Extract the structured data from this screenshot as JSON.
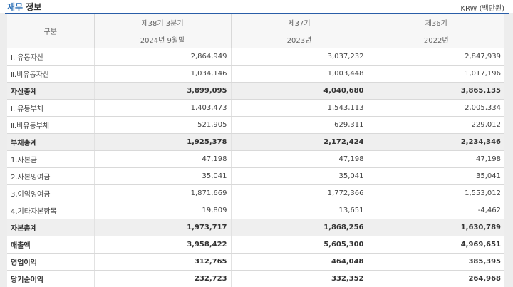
{
  "header": {
    "title_accent": "재무",
    "title_rest": " 정보",
    "unit": "KRW (백만원)"
  },
  "table": {
    "corner": "구분",
    "periods": [
      {
        "term": "제38기 3분기",
        "date": "2024년 9월말"
      },
      {
        "term": "제37기",
        "date": "2023년"
      },
      {
        "term": "제36기",
        "date": "2022년"
      }
    ],
    "rows": [
      {
        "label": "Ⅰ. 유동자산",
        "values": [
          "2,864,949",
          "3,037,232",
          "2,847,939"
        ],
        "style": "normal"
      },
      {
        "label": "Ⅱ.비유동자산",
        "values": [
          "1,034,146",
          "1,003,448",
          "1,017,196"
        ],
        "style": "normal"
      },
      {
        "label": "자산총계",
        "values": [
          "3,899,095",
          "4,040,680",
          "3,865,135"
        ],
        "style": "total"
      },
      {
        "label": "Ⅰ. 유동부채",
        "values": [
          "1,403,473",
          "1,543,113",
          "2,005,334"
        ],
        "style": "normal"
      },
      {
        "label": "Ⅱ.비유동부채",
        "values": [
          "521,905",
          "629,311",
          "229,012"
        ],
        "style": "normal"
      },
      {
        "label": "부채총계",
        "values": [
          "1,925,378",
          "2,172,424",
          "2,234,346"
        ],
        "style": "total"
      },
      {
        "label": "1.자본금",
        "values": [
          "47,198",
          "47,198",
          "47,198"
        ],
        "style": "normal"
      },
      {
        "label": "2.자본잉여금",
        "values": [
          "35,041",
          "35,041",
          "35,041"
        ],
        "style": "normal"
      },
      {
        "label": "3.이익잉여금",
        "values": [
          "1,871,669",
          "1,772,366",
          "1,553,012"
        ],
        "style": "normal"
      },
      {
        "label": "4.기타자본항목",
        "values": [
          "19,809",
          "13,651",
          "-4,462"
        ],
        "style": "normal"
      },
      {
        "label": "자본총계",
        "values": [
          "1,973,717",
          "1,868,256",
          "1,630,789"
        ],
        "style": "total"
      },
      {
        "label": "매출액",
        "values": [
          "3,958,422",
          "5,605,300",
          "4,969,651"
        ],
        "style": "bold"
      },
      {
        "label": "영업이익",
        "values": [
          "312,765",
          "464,048",
          "385,395"
        ],
        "style": "bold"
      },
      {
        "label": "당기순이익",
        "values": [
          "232,723",
          "332,352",
          "264,968"
        ],
        "style": "bold"
      }
    ]
  }
}
